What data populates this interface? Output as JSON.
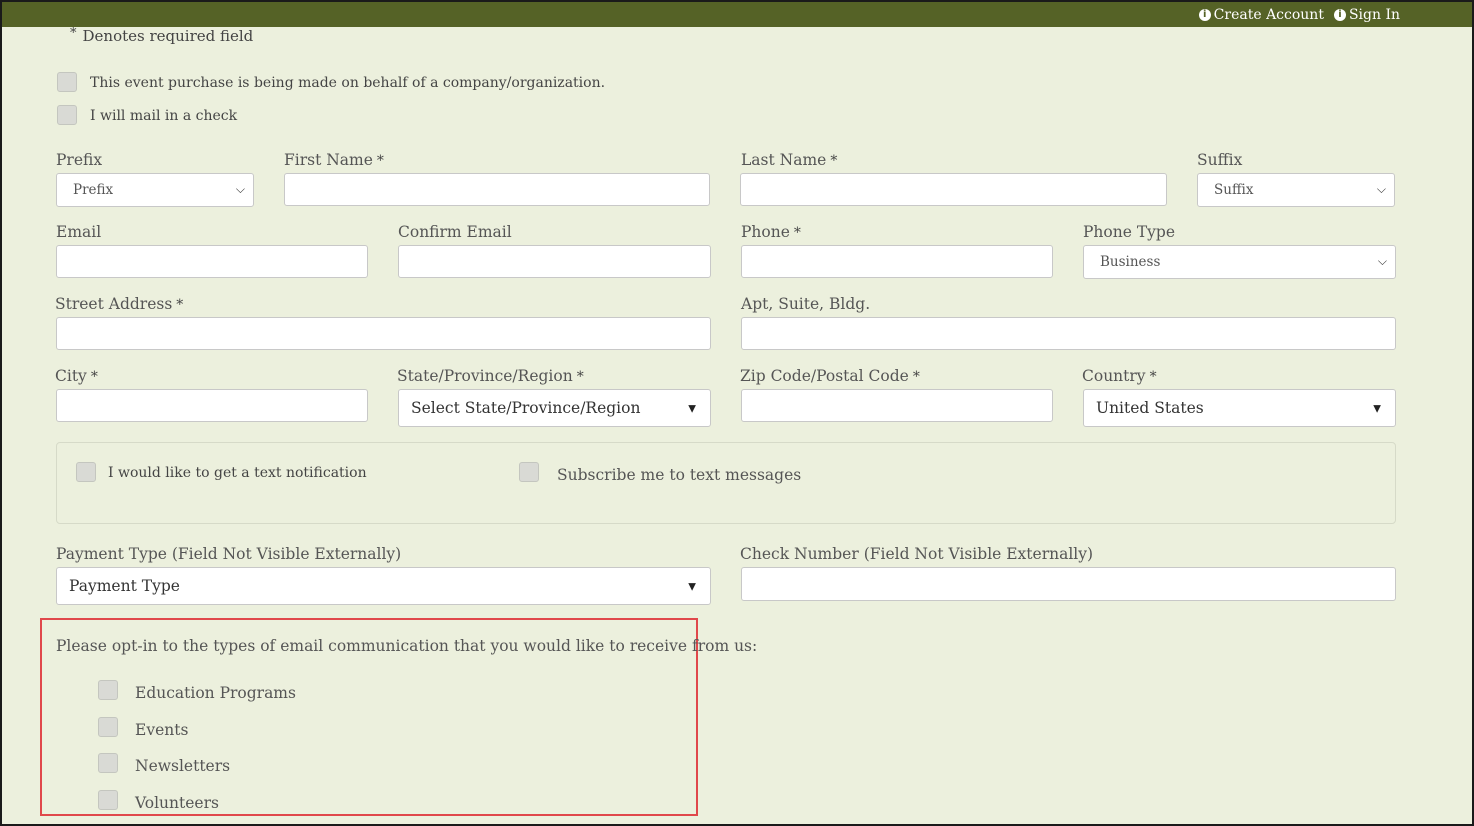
{
  "topnav": {
    "create_account": "Create Account",
    "sign_in": "Sign In"
  },
  "required_note": {
    "star": "*",
    "text": "Denotes required field"
  },
  "checkboxes_top": [
    {
      "label": "This event purchase is being made on behalf of a company/organization."
    },
    {
      "label": "I will mail in a check"
    }
  ],
  "form": {
    "prefix": {
      "label": "Prefix",
      "selected": "Prefix"
    },
    "first_name": {
      "label": "First Name",
      "required": "*",
      "value": ""
    },
    "last_name": {
      "label": "Last Name",
      "required": "*",
      "value": ""
    },
    "suffix": {
      "label": "Suffix",
      "selected": "Suffix"
    },
    "email": {
      "label": "Email",
      "value": ""
    },
    "confirm_email": {
      "label": "Confirm Email",
      "value": ""
    },
    "phone": {
      "label": "Phone",
      "required": "*",
      "value": ""
    },
    "phone_type": {
      "label": "Phone Type",
      "selected": "Business"
    },
    "street": {
      "label": "Street Address",
      "required": "*",
      "value": ""
    },
    "apt": {
      "label": "Apt, Suite, Bldg.",
      "value": ""
    },
    "city": {
      "label": "City",
      "required": "*",
      "value": ""
    },
    "state": {
      "label": "State/Province/Region",
      "required": "*",
      "selected": "Select State/Province/Region"
    },
    "zip": {
      "label": "Zip Code/Postal Code",
      "required": "*",
      "value": ""
    },
    "country": {
      "label": "Country",
      "required": "*",
      "selected": "United States"
    },
    "text_notification": {
      "label": "I would like to get a text notification"
    },
    "subscribe_text": {
      "label": "Subscribe me to text messages"
    },
    "payment_type": {
      "label": "Payment Type (Field Not Visible Externally)",
      "selected": "Payment Type"
    },
    "check_number": {
      "label": "Check Number (Field Not Visible Externally)",
      "value": ""
    }
  },
  "optin": {
    "title": "Please opt-in to the types of email communication that you would like to receive from us:",
    "options": [
      "Education Programs",
      "Events",
      "Newsletters",
      "Volunteers"
    ]
  },
  "colors": {
    "topbar": "#556226",
    "background": "#ecf0dd",
    "highlight": "#e0484b"
  }
}
